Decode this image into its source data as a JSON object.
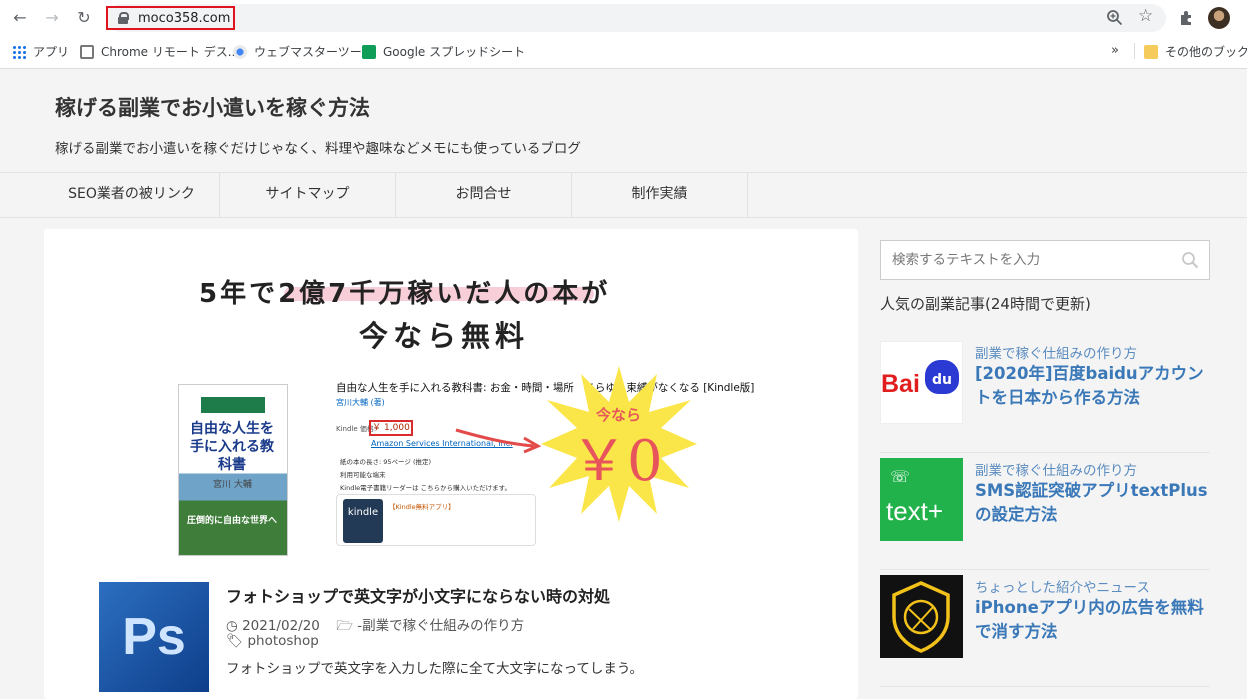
{
  "browser": {
    "url": "moco358.com",
    "bookmarks": [
      "アプリ",
      "Chrome リモート デス...",
      "ウェブマスターツール",
      "Google スプレッドシート"
    ],
    "overflow": "»",
    "other_bookmarks": "その他のブックマー"
  },
  "site": {
    "title": "稼げる副業でお小遣いを稼ぐ方法",
    "description": "稼げる副業でお小遣いを稼ぐだけじゃなく、料理や趣味などメモにも使っているブログ"
  },
  "nav": [
    "SEO業者の被リンク",
    "サイトマップ",
    "お問合せ",
    "制作実績"
  ],
  "banner": {
    "line1": "5年で2億7千万稼いだ人の本が",
    "line2": "今なら無料",
    "book_title": "自由な人生を手に入れる教科書",
    "book_author": "宮川 大輔",
    "book_tagline": "圧倒的に自由な世界へ",
    "product_title": "自由な人生を手に入れる教科書: お金・時間・場所　あらゆる束縛がなくなる [Kindle版]",
    "product_author": "宮川大輔 (著)",
    "price_label": "Kindle 価格:",
    "price": "￥ 1,000",
    "seller": "Amazon Services International, Inc.",
    "bullets": [
      "紙の本の長さ: 95ページ (推定)",
      "利用可能な端末",
      "Kindle電子書籍リーダーは こちらから購入いただけます。"
    ],
    "kindle_logo": "kindle",
    "kindle_app": "【Kindle無料アプリ】",
    "burst_small": "今なら",
    "burst_big": "￥0"
  },
  "post": {
    "thumb": "Ps",
    "title": "フォトショップで英文字が小文字にならない時の対処",
    "date": "2021/02/20",
    "category": "-副業で稼ぐ仕組みの作り方",
    "tag": "photoshop",
    "excerpt": "フォトショップで英文字を入力した際に全て大文字になってしまう。"
  },
  "sidebar": {
    "search_placeholder": "検索するテキストを入力",
    "widget_title": "人気の副業記事(24時間で更新)",
    "items": [
      {
        "category": "副業で稼ぐ仕組みの作り方",
        "title": "[2020年]百度baiduアカウントを日本から作る方法",
        "thumb": "Bai du"
      },
      {
        "category": "副業で稼ぐ仕組みの作り方",
        "title": "SMS認証突破アプリtextPlusの設定方法",
        "thumb": "text+"
      },
      {
        "category": "ちょっとした紹介やニュース",
        "title": "iPhoneアプリ内の広告を無料で消す方法",
        "thumb": ""
      }
    ]
  },
  "colors": {
    "accent_link": "#3a78b8",
    "url_highlight": "#e0141e",
    "burst_yellow": "#fbe64a"
  }
}
